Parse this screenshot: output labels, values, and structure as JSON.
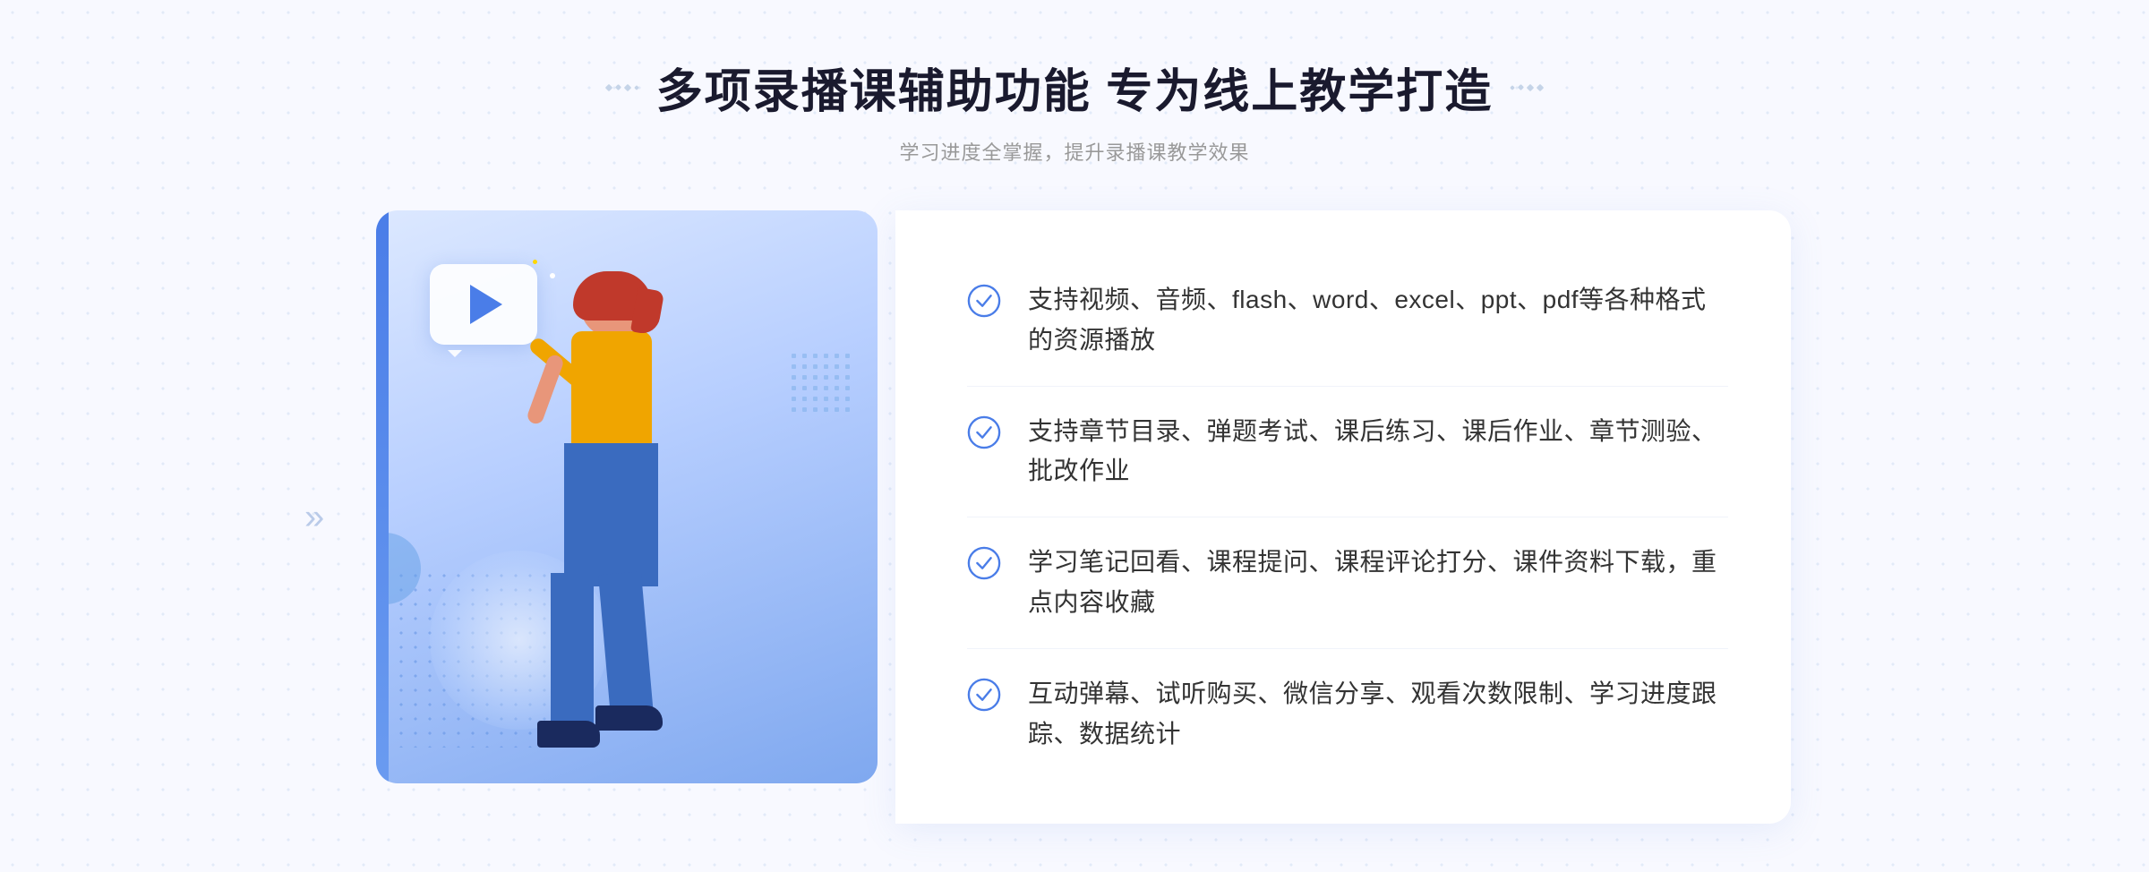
{
  "header": {
    "title": "多项录播课辅助功能 专为线上教学打造",
    "subtitle": "学习进度全掌握，提升录播课教学效果"
  },
  "features": [
    {
      "id": 1,
      "text": "支持视频、音频、flash、word、excel、ppt、pdf等各种格式的资源播放"
    },
    {
      "id": 2,
      "text": "支持章节目录、弹题考试、课后练习、课后作业、章节测验、批改作业"
    },
    {
      "id": 3,
      "text": "学习笔记回看、课程提问、课程评论打分、课件资料下载，重点内容收藏"
    },
    {
      "id": 4,
      "text": "互动弹幕、试听购买、微信分享、观看次数限制、学习进度跟踪、数据统计"
    }
  ],
  "icons": {
    "check_color": "#4a7de8",
    "chevron_color": "#a0b8e0"
  }
}
